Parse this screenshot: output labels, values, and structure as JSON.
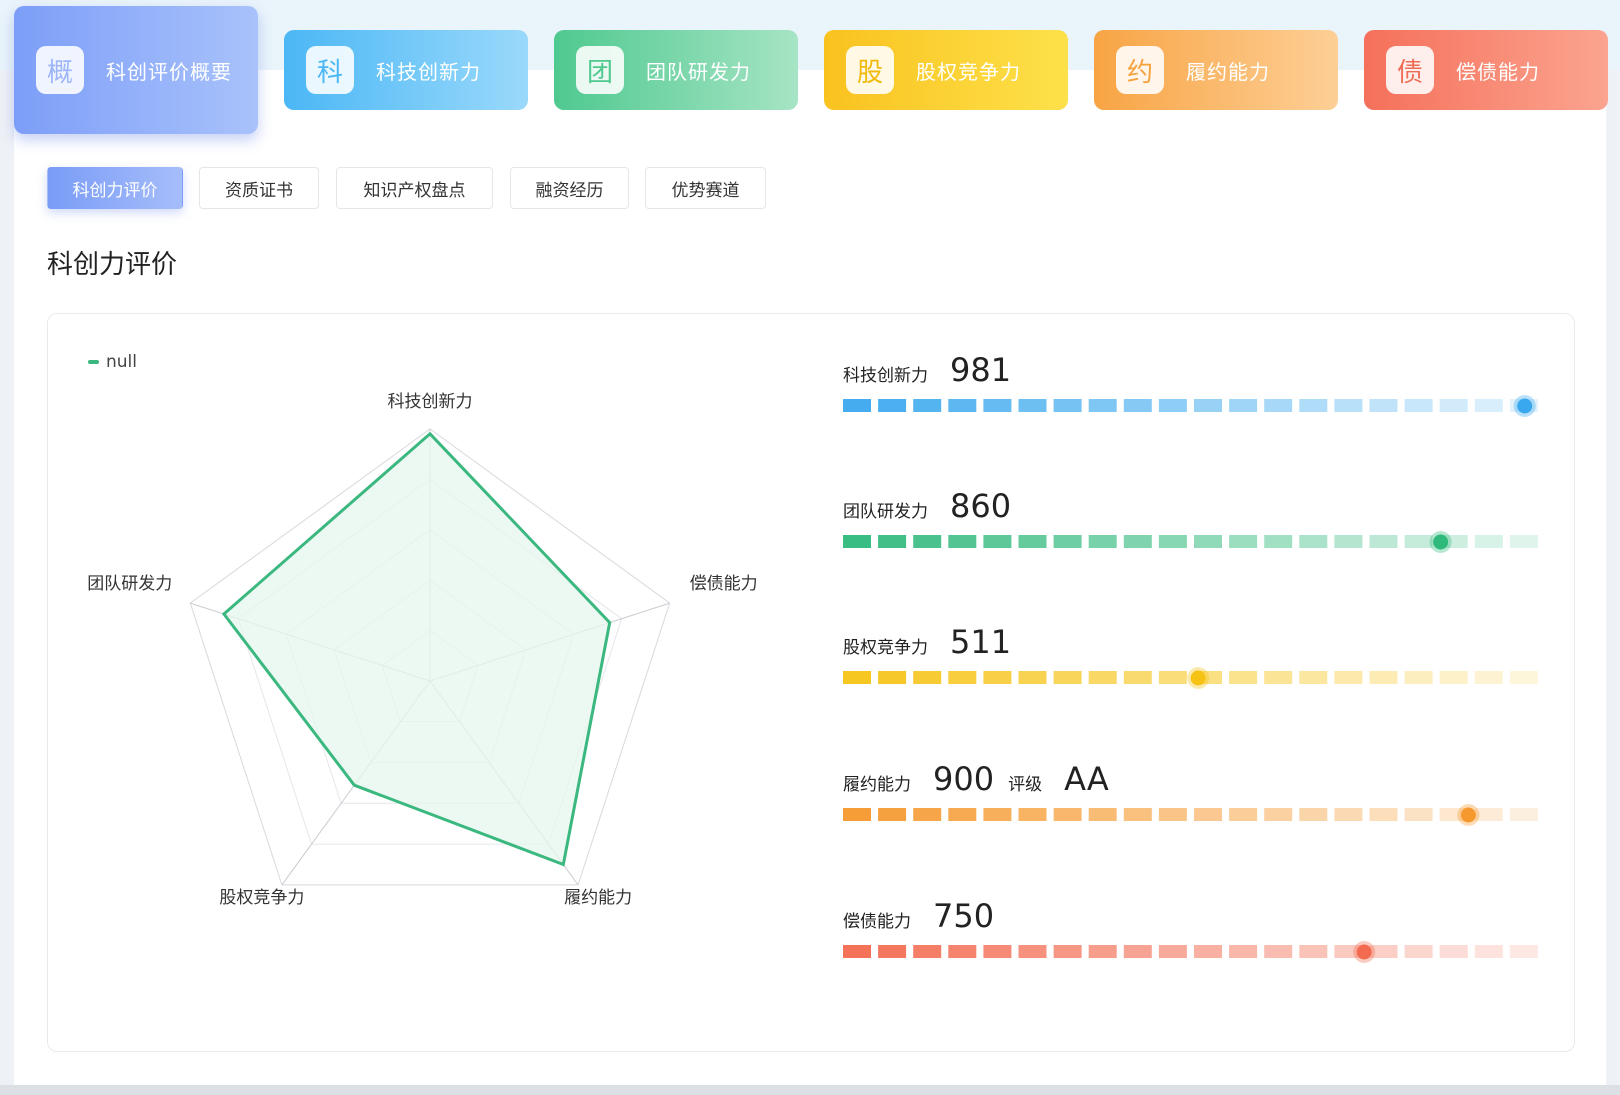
{
  "tabs": [
    {
      "icon_char": "概",
      "label": "科创评价概要",
      "from": "#7d9ef8",
      "to": "#a9c2fb",
      "icon_color": "#9db6fa",
      "active": true
    },
    {
      "icon_char": "科",
      "label": "科技创新力",
      "from": "#4bb7f5",
      "to": "#9ad9fb",
      "icon_color": "#4bb7f5",
      "active": false
    },
    {
      "icon_char": "团",
      "label": "团队研发力",
      "from": "#4fc98f",
      "to": "#a6e4c5",
      "icon_color": "#4fc98f",
      "active": false
    },
    {
      "icon_char": "股",
      "label": "股权竞争力",
      "from": "#f9c21f",
      "to": "#fde14a",
      "icon_color": "#f1b90c",
      "active": false
    },
    {
      "icon_char": "约",
      "label": "履约能力",
      "from": "#f8a444",
      "to": "#fdcf96",
      "icon_color": "#f5a13c",
      "active": false
    },
    {
      "icon_char": "债",
      "label": "偿债能力",
      "from": "#f5705a",
      "to": "#fba48f",
      "icon_color": "#ef6c56",
      "active": false
    }
  ],
  "subtabs": [
    "科创力评价",
    "资质证书",
    "知识产权盘点",
    "融资经历",
    "优势赛道"
  ],
  "section_title": "科创力评价",
  "scores": [
    {
      "label": "科技创新力",
      "value": "981",
      "fraction": 0.981,
      "color": "#3aa8ee"
    },
    {
      "label": "团队研发力",
      "value": "860",
      "fraction": 0.86,
      "color": "#2fb97b"
    },
    {
      "label": "股权竞争力",
      "value": "511",
      "fraction": 0.511,
      "color": "#f6c315"
    },
    {
      "label": "履约能力",
      "value": "900",
      "fraction": 0.9,
      "color": "#f5982d",
      "rating_label": "评级",
      "rating_value": "AA"
    },
    {
      "label": "偿债能力",
      "value": "750",
      "fraction": 0.75,
      "color": "#f26a4f"
    }
  ],
  "chart_data": {
    "type": "radar",
    "legend": [
      "null"
    ],
    "indicators": [
      "科技创新力",
      "偿债能力",
      "履约能力",
      "股权竞争力",
      "团队研发力"
    ],
    "max": 1000,
    "series": [
      {
        "values": [
          981,
          750,
          900,
          511,
          860
        ]
      }
    ],
    "line_color": "#3bb87f",
    "fill_color": "#e6f7ee"
  }
}
